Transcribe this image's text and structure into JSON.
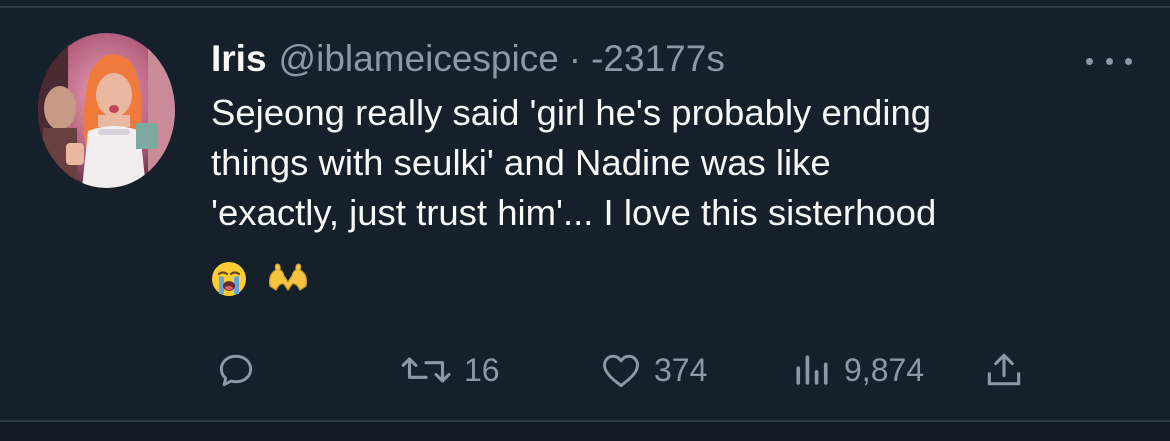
{
  "tweet": {
    "display_name": "Iris",
    "handle": "@iblameicespice",
    "separator": "·",
    "timestamp": "-23177s",
    "text_lines": [
      "Sejeong really said 'girl he's probably ending",
      "things with seulki' and Nadine was like",
      "'exactly, just trust him'... I love this sisterhood"
    ],
    "emojis": [
      "loudly-crying-face",
      "heart-hands"
    ]
  },
  "actions": {
    "reply": {
      "icon": "reply-icon",
      "count": ""
    },
    "retweet": {
      "icon": "retweet-icon",
      "count": "16"
    },
    "like": {
      "icon": "heart-icon",
      "count": "374"
    },
    "views": {
      "icon": "views-icon",
      "count": "9,874"
    },
    "share": {
      "icon": "share-icon",
      "count": ""
    }
  },
  "colors": {
    "background": "#15202b",
    "primary_text": "#f7f9f9",
    "secondary_text": "#8b98a5",
    "divider": "#2f3a46"
  }
}
